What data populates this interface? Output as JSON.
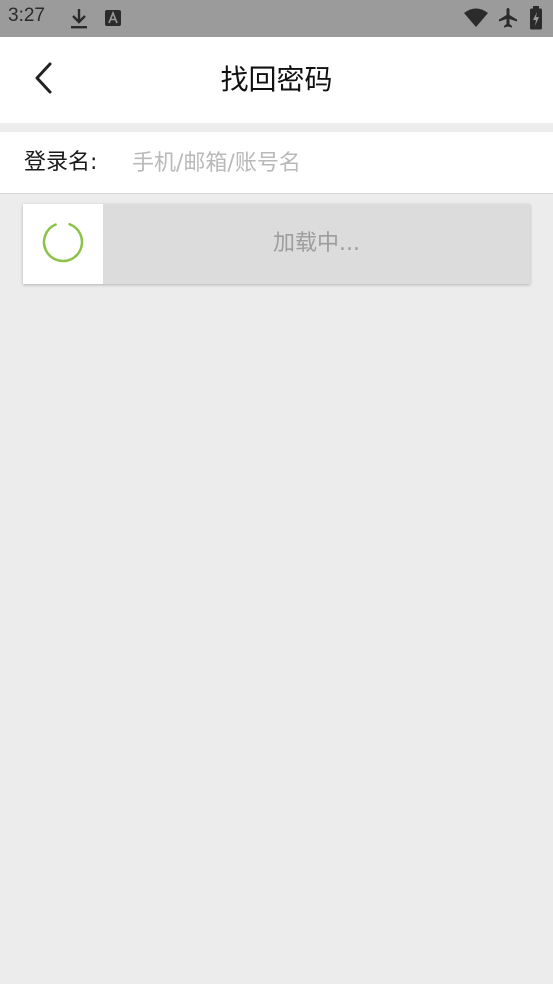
{
  "status_bar": {
    "time": "3:27",
    "icons": [
      "download-icon",
      "keyboard-a-icon",
      "wifi-icon",
      "airplane-mode-icon",
      "battery-charging-icon"
    ]
  },
  "app_bar": {
    "title": "找回密码",
    "back_icon": "chevron-left-icon"
  },
  "form": {
    "login_label": "登录名:",
    "login_placeholder": "手机/邮箱/账号名",
    "login_value": ""
  },
  "loading": {
    "text": "加载中...",
    "spinner_color": "#8bc34a"
  },
  "colors": {
    "status_bar_bg": "#9b9b9b",
    "page_bg": "#ececec",
    "card_bg": "#dcdcdc",
    "accent": "#8bc34a"
  }
}
